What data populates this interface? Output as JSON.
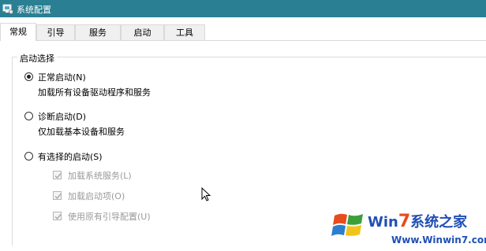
{
  "window": {
    "title": "系统配置",
    "titlebar_color": "#2a7f93"
  },
  "tabs": [
    {
      "label": "常规",
      "active": true
    },
    {
      "label": "引导",
      "active": false
    },
    {
      "label": "服务",
      "active": false
    },
    {
      "label": "启动",
      "active": false
    },
    {
      "label": "工具",
      "active": false
    }
  ],
  "startup_selection": {
    "group_title": "启动选择",
    "options": [
      {
        "label": "正常启动(N)",
        "description": "加载所有设备驱动程序和服务",
        "checked": true
      },
      {
        "label": "诊断启动(D)",
        "description": "仅加载基本设备和服务",
        "checked": false
      },
      {
        "label": "有选择的启动(S)",
        "description": "",
        "checked": false
      }
    ],
    "selective_items": [
      {
        "label": "加载系统服务(L)",
        "checked": true,
        "disabled": true
      },
      {
        "label": "加载启动项(O)",
        "checked": true,
        "disabled": true
      },
      {
        "label": "使用原有引导配置(U)",
        "checked": true,
        "disabled": true
      }
    ]
  },
  "watermark": {
    "brand_prefix": "Win",
    "brand_number": "7",
    "brand_suffix": "系统之家",
    "url": "Www.Winwin7.com"
  }
}
